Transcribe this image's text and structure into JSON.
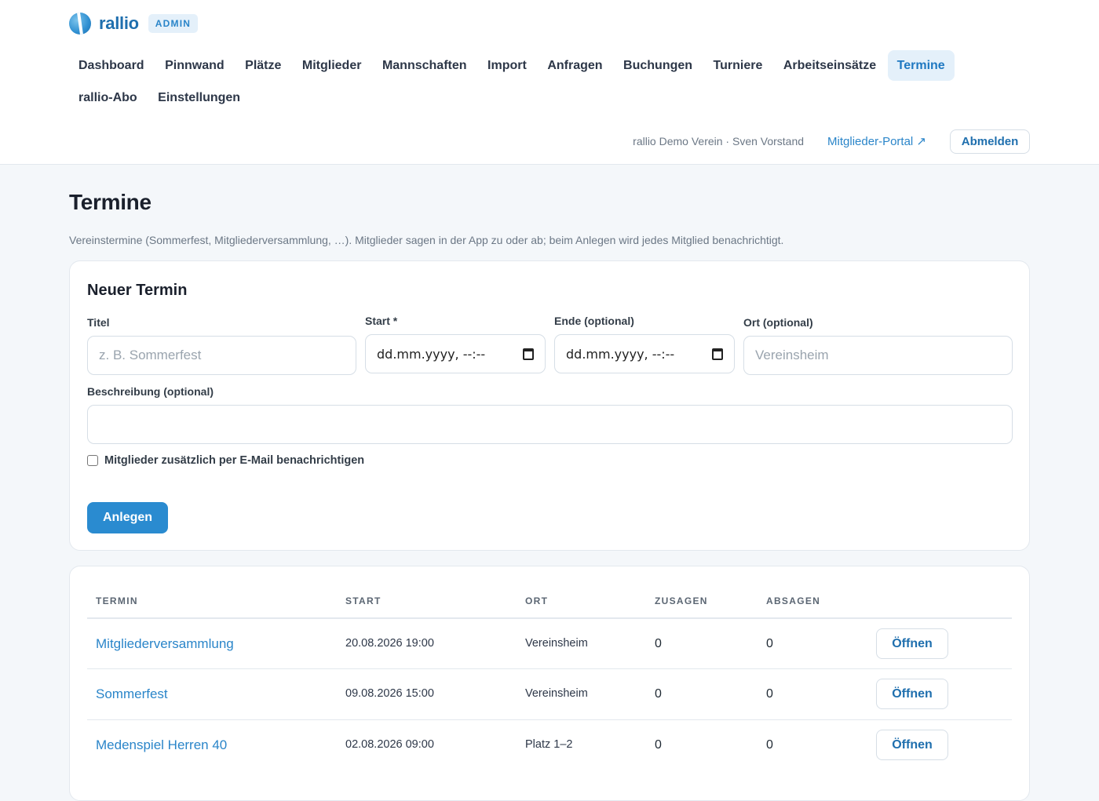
{
  "brand": {
    "name": "rallio",
    "badge": "ADMIN"
  },
  "nav": [
    {
      "label": "Dashboard",
      "active": false
    },
    {
      "label": "Pinnwand",
      "active": false
    },
    {
      "label": "Plätze",
      "active": false
    },
    {
      "label": "Mitglieder",
      "active": false
    },
    {
      "label": "Mannschaften",
      "active": false
    },
    {
      "label": "Import",
      "active": false
    },
    {
      "label": "Anfragen",
      "active": false
    },
    {
      "label": "Buchungen",
      "active": false
    },
    {
      "label": "Turniere",
      "active": false
    },
    {
      "label": "Arbeitseinsätze",
      "active": false
    },
    {
      "label": "Termine",
      "active": true
    },
    {
      "label": "rallio-Abo",
      "active": false
    },
    {
      "label": "Einstellungen",
      "active": false
    }
  ],
  "user": {
    "info": "rallio Demo Verein · Sven Vorstand",
    "portal_link": "Mitglieder-Portal ↗",
    "logout_label": "Abmelden"
  },
  "page": {
    "title": "Termine",
    "description": "Vereinstermine (Sommerfest, Mitgliederversammlung, …). Mitglieder sagen in der App zu oder ab; beim Anlegen wird jedes Mitglied benachrichtigt."
  },
  "form": {
    "title": "Neuer Termin",
    "titel_label": "Titel",
    "titel_placeholder": "z. B. Sommerfest",
    "start_label": "Start *",
    "start_value": "dd.mm.yyyy, --:--",
    "ende_label": "Ende (optional)",
    "ende_value": "dd.mm.yyyy, --:--",
    "ort_label": "Ort (optional)",
    "ort_placeholder": "Vereinsheim",
    "beschreibung_label": "Beschreibung (optional)",
    "beschreibung_placeholder": "",
    "email_checkbox_label": "Mitglieder zusätzlich per E-Mail benachrichtigen",
    "email_checked": false,
    "submit_label": "Anlegen"
  },
  "table": {
    "headers": {
      "termin": "TERMIN",
      "start": "START",
      "ort": "ORT",
      "zusagen": "ZUSAGEN",
      "absagen": "ABSAGEN"
    },
    "open_label": "Öffnen",
    "rows": [
      {
        "termin": "Mitgliederversammlung",
        "start": "20.08.2026 19:00",
        "ort": "Vereinsheim",
        "zusagen": "0",
        "absagen": "0"
      },
      {
        "termin": "Sommerfest",
        "start": "09.08.2026 15:00",
        "ort": "Vereinsheim",
        "zusagen": "0",
        "absagen": "0"
      },
      {
        "termin": "Medenspiel Herren 40",
        "start": "02.08.2026 09:00",
        "ort": "Platz 1–2",
        "zusagen": "0",
        "absagen": "0"
      }
    ]
  }
}
